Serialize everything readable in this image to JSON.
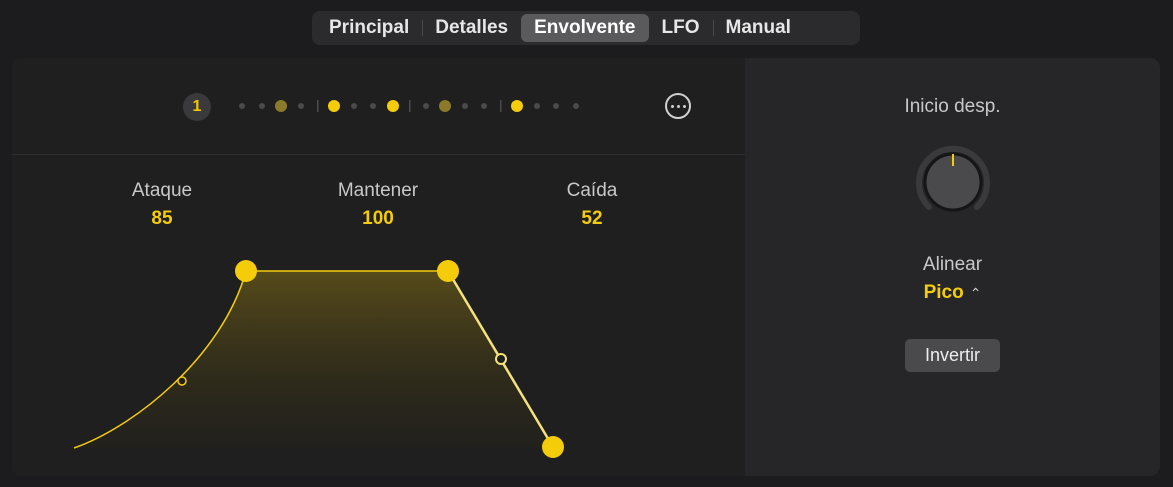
{
  "tabs": {
    "principal": "Principal",
    "detalles": "Detalles",
    "envolvente": "Envolvente",
    "lfo": "LFO",
    "manual": "Manual",
    "selected": "Envolvente"
  },
  "envelope": {
    "index_badge": "1",
    "more_icon": "ellipsis-circle-icon",
    "attack": {
      "label": "Ataque",
      "value": "85"
    },
    "hold": {
      "label": "Mantener",
      "value": "100"
    },
    "decay": {
      "label": "Caída",
      "value": "52"
    }
  },
  "offset": {
    "label": "Inicio desp.",
    "knob_icon": "rotary-knob-icon"
  },
  "align": {
    "label": "Alinear",
    "value": "Pico",
    "chevron_icon": "chevron-up-down-icon"
  },
  "invert": {
    "label": "Invertir"
  },
  "colors": {
    "accent": "#f5cc0a",
    "panel": "#1f1f20",
    "background": "#1c1c1e"
  }
}
